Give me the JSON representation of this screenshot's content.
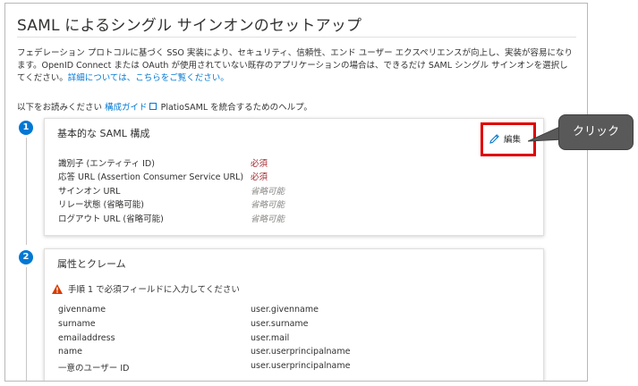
{
  "page": {
    "title": "SAML によるシングル サインオンのセットアップ",
    "intro_text": "フェデレーション プロトコルに基づく SSO 実装により、セキュリティ、信頼性、エンド ユーザー エクスペリエンスが向上し、実装が容易になります。OpenID Connect または OAuth が使用されていない既存のアプリケーションの場合は、できるだけ SAML シングル サインオンを選択してください。",
    "intro_link": "詳細については、こちらをご覧ください。",
    "guide_prefix": "以下をお読みください",
    "guide_link": "構成ガイド",
    "guide_suffix": "PlatioSAML を統合するためのヘルプ。"
  },
  "steps": [
    {
      "number": "1",
      "title": "基本的な SAML 構成",
      "edit_label": "編集",
      "rows": [
        {
          "label": "識別子 (エンティティ ID)",
          "value": "必須",
          "status": "required"
        },
        {
          "label": "応答 URL (Assertion Consumer Service URL)",
          "value": "必須",
          "status": "required"
        },
        {
          "label": "サインオン URL",
          "value": "省略可能",
          "status": "optional"
        },
        {
          "label": "リレー状態 (省略可能)",
          "value": "省略可能",
          "status": "optional"
        },
        {
          "label": "ログアウト URL (省略可能)",
          "value": "省略可能",
          "status": "optional"
        }
      ]
    },
    {
      "number": "2",
      "title": "属性とクレーム",
      "warning": "手順 1 で必須フィールドに入力してください",
      "rows": [
        {
          "label": "givenname",
          "value": "user.givenname"
        },
        {
          "label": "surname",
          "value": "user.surname"
        },
        {
          "label": "emailaddress",
          "value": "user.mail"
        },
        {
          "label": "name",
          "value": "user.userprincipalname"
        },
        {
          "label": "一意のユーザー ID",
          "value": "user.userprincipalname"
        }
      ]
    }
  ],
  "callout": {
    "text": "クリック"
  },
  "colors": {
    "accent": "#0078d4",
    "required": "#a4262c",
    "highlight": "#e00000",
    "callout_bg": "#595959",
    "warning": "#d83b01"
  },
  "icons": [
    "pencil-icon",
    "external-link-icon",
    "warning-icon"
  ]
}
